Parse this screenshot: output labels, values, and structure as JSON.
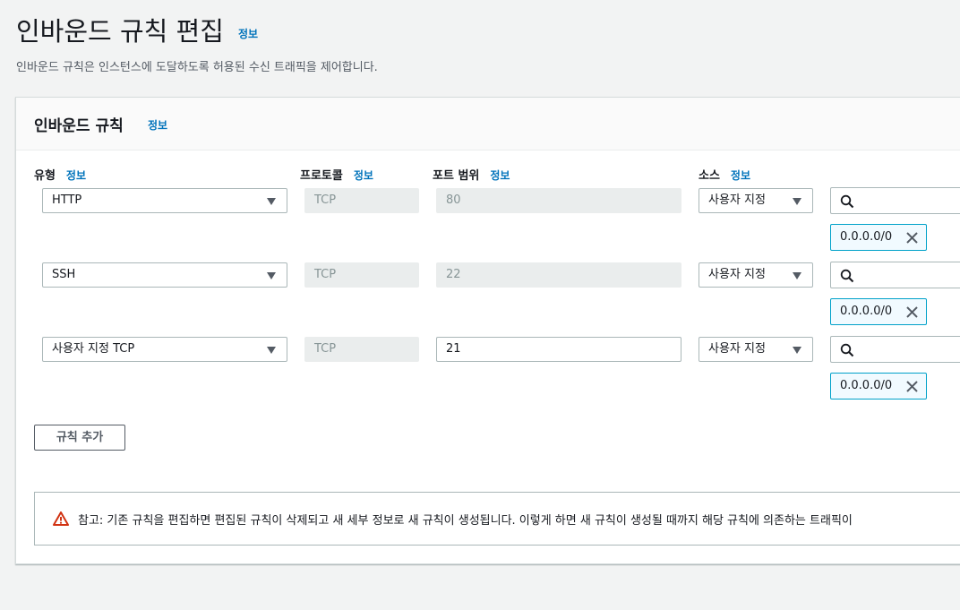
{
  "page": {
    "title": "인바운드 규칙 편집",
    "info": "정보",
    "description": "인바운드 규칙은 인스턴스에 도달하도록 허용된 수신 트래픽을 제어합니다."
  },
  "panel": {
    "title": "인바운드 규칙",
    "info": "정보"
  },
  "columns": {
    "type": "유형",
    "protocol": "프로토콜",
    "port_range": "포트 범위",
    "source": "소스",
    "info": "정보"
  },
  "rules": [
    {
      "type": "HTTP",
      "protocol": "TCP",
      "port": "80",
      "port_editable": false,
      "source_type": "사용자 지정",
      "cidr": "0.0.0.0/0"
    },
    {
      "type": "SSH",
      "protocol": "TCP",
      "port": "22",
      "port_editable": false,
      "source_type": "사용자 지정",
      "cidr": "0.0.0.0/0"
    },
    {
      "type": "사용자 지정 TCP",
      "protocol": "TCP",
      "port": "21",
      "port_editable": true,
      "source_type": "사용자 지정",
      "cidr": "0.0.0.0/0"
    }
  ],
  "buttons": {
    "add_rule": "규칙 추가"
  },
  "alert": {
    "text": "참고: 기존 규칙을 편집하면 편집된 규칙이 삭제되고 새 세부 정보로 새 규칙이 생성됩니다. 이렇게 하면 새 규칙이 생성될 때까지 해당 규칙에 의존하는 트래픽이",
    "color": "#d13212"
  },
  "colors": {
    "link": "#0073bb",
    "token_border": "#00a1c9"
  }
}
